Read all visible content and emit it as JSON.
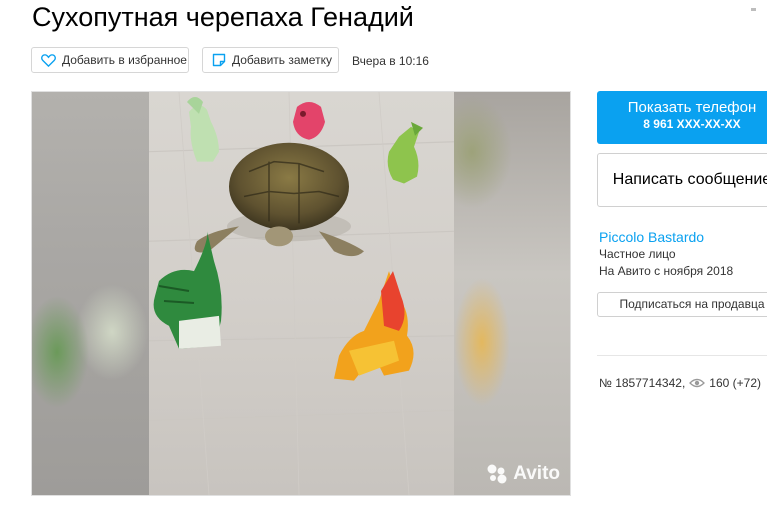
{
  "listing": {
    "title": "Сухопутная черепаха Генадий",
    "favorite_label": "Добавить в избранное",
    "note_label": "Добавить заметку",
    "posted": "Вчера в 10:16"
  },
  "gallery": {
    "watermark": "Avito"
  },
  "sidebar": {
    "phone_label": "Показать телефон",
    "phone_number": "8 961 XXX-XX-XX",
    "message_label": "Написать сообщение",
    "seller_name": "Piccolo Bastardo",
    "seller_type": "Частное лицо",
    "seller_since": "На Авито с ноября 2018",
    "subscribe_label": "Подписаться на продавца",
    "item_number": "№ 1857714342,",
    "views": "160 (+72)"
  },
  "colors": {
    "accent": "#0aa1f0",
    "border": "#d0d0d0"
  },
  "icons": [
    "heart-icon",
    "note-icon",
    "avito-logo-icon",
    "eye-icon"
  ]
}
